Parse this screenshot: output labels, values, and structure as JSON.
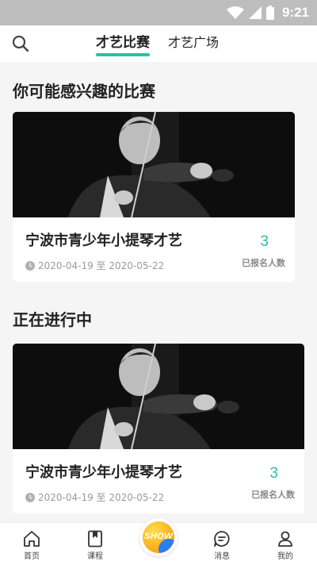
{
  "status_bar": {
    "time": "9:21"
  },
  "header": {
    "tabs": [
      {
        "label": "才艺比赛",
        "active": true
      },
      {
        "label": "才艺广场",
        "active": false
      }
    ]
  },
  "sections": [
    {
      "title": "你可能感兴趣的比赛",
      "card": {
        "title": "宁波市青少年小提琴才艺",
        "date_range": "2020-04-19 至 2020-05-22",
        "count": "3",
        "count_label": "已报名人数"
      }
    },
    {
      "title": "正在进行中",
      "card": {
        "title": "宁波市青少年小提琴才艺",
        "date_range": "2020-04-19 至 2020-05-22",
        "count": "3",
        "count_label": "已报名人数"
      }
    }
  ],
  "bottom_nav": {
    "items": [
      {
        "label": "首页",
        "icon": "home-icon"
      },
      {
        "label": "课程",
        "icon": "bookmark-icon"
      },
      {
        "label": "SHOW",
        "icon": "show-icon"
      },
      {
        "label": "消息",
        "icon": "message-icon"
      },
      {
        "label": "我的",
        "icon": "profile-icon"
      }
    ]
  },
  "colors": {
    "accent": "#26c2a6",
    "status_bar": "#bdbdbd",
    "background": "#f5f5f5"
  }
}
